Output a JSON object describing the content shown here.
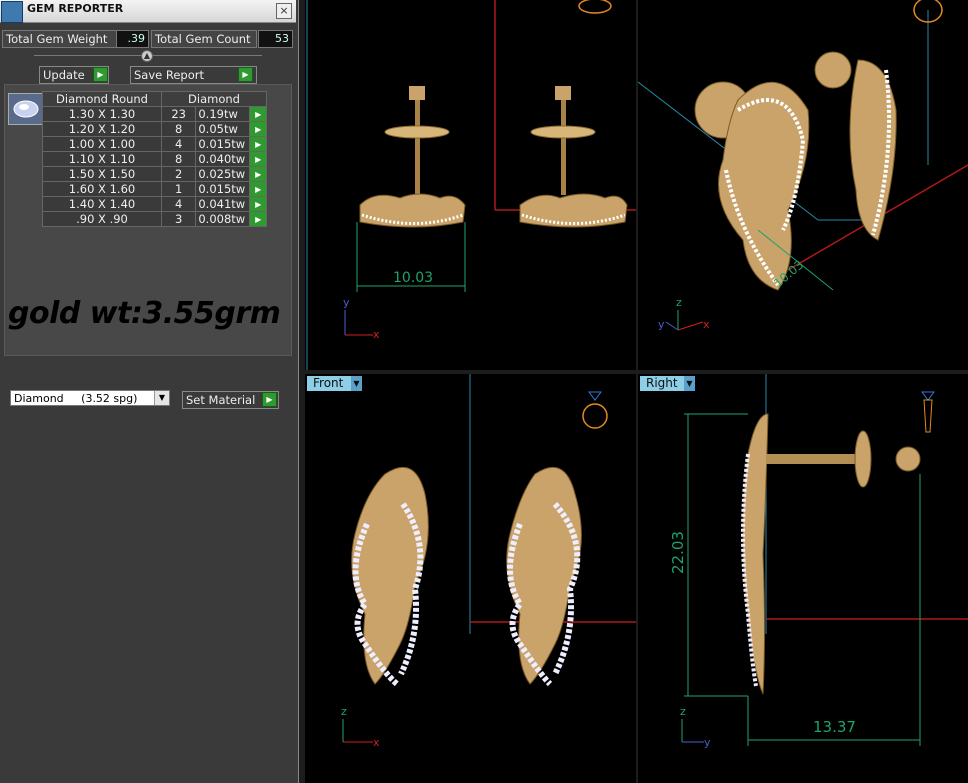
{
  "window": {
    "title": "GEM REPORTER",
    "close_glyph": "×"
  },
  "stats": {
    "total_weight_label": "Total Gem Weight",
    "total_weight_value": ".39",
    "total_count_label": "Total Gem Count",
    "total_count_value": "53"
  },
  "actions": {
    "update_label": "Update",
    "save_report_label": "Save Report",
    "set_material_label": "Set Material"
  },
  "table": {
    "headers": [
      "Diamond Round",
      "Diamond"
    ],
    "rows": [
      {
        "size": "1.30 X 1.30",
        "count": "23",
        "weight": "0.19tw"
      },
      {
        "size": "1.20 X 1.20",
        "count": "8",
        "weight": "0.05tw"
      },
      {
        "size": "1.00 X 1.00",
        "count": "4",
        "weight": "0.015tw"
      },
      {
        "size": "1.10 X 1.10",
        "count": "8",
        "weight": "0.040tw"
      },
      {
        "size": "1.50 X 1.50",
        "count": "2",
        "weight": "0.025tw"
      },
      {
        "size": "1.60 X 1.60",
        "count": "1",
        "weight": "0.015tw"
      },
      {
        "size": "1.40 X 1.40",
        "count": "4",
        "weight": "0.041tw"
      },
      {
        "size": ".90 X .90",
        "count": "3",
        "weight": "0.008tw"
      }
    ]
  },
  "note": "gold wt:3.55grm",
  "material": {
    "selected": "Diamond     (3.52 spg)"
  },
  "viewports": {
    "top": {
      "dimension": "10.03",
      "axis_y": "y",
      "axis_x": "x"
    },
    "perspective": {
      "dimension": "10.03",
      "axis_z": "z",
      "axis_y": "y",
      "axis_x": "x"
    },
    "front": {
      "label": "Front",
      "axis_z": "z",
      "axis_x": "x"
    },
    "right": {
      "label": "Right",
      "height_dim": "22.03",
      "width_dim": "13.37",
      "axis_z": "z",
      "axis_y": "y"
    }
  },
  "colors": {
    "gold": "#c9a36a",
    "accent_blue": "#8ecfe8",
    "dim_green": "#1fa36a",
    "green_button": "#2f9a2f"
  }
}
